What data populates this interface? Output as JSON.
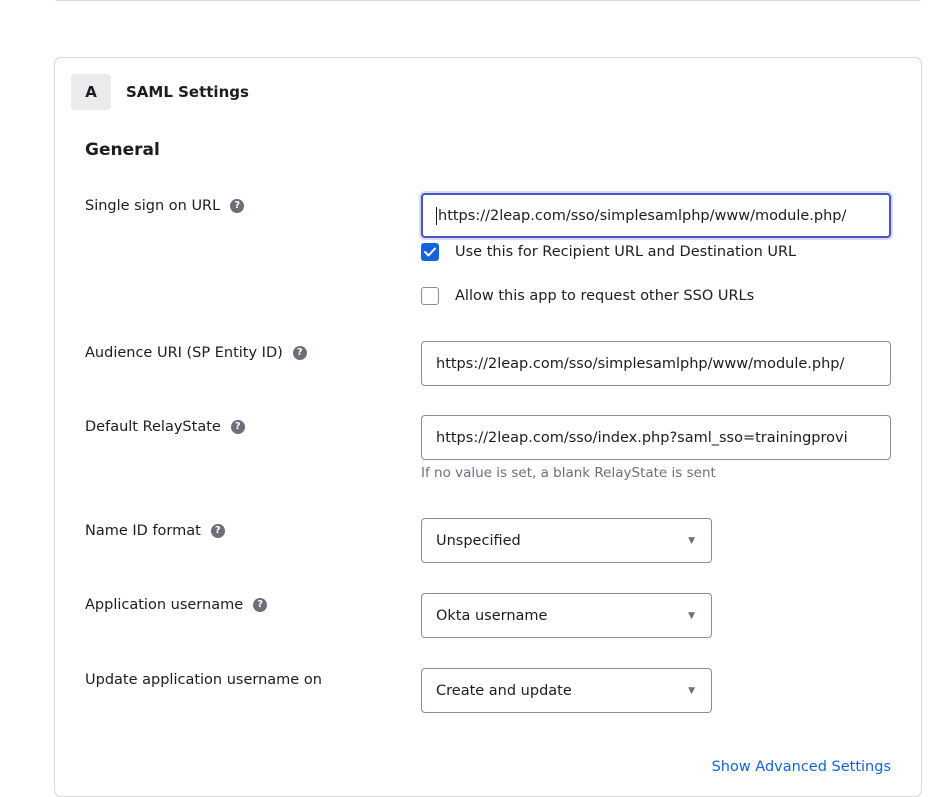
{
  "step": {
    "badge": "A",
    "title": "SAML Settings"
  },
  "section": {
    "title": "General"
  },
  "fields": {
    "sso_url": {
      "label": "Single sign on URL",
      "value": "https://2leap.com/sso/simplesamlphp/www/module.php/"
    },
    "recipient_checkbox": {
      "label": "Use this for Recipient URL and Destination URL",
      "checked": true
    },
    "other_sso_checkbox": {
      "label": "Allow this app to request other SSO URLs",
      "checked": false
    },
    "audience_uri": {
      "label": "Audience URI (SP Entity ID)",
      "value": "https://2leap.com/sso/simplesamlphp/www/module.php/"
    },
    "relay_state": {
      "label": "Default RelayState",
      "value": "https://2leap.com/sso/index.php?saml_sso=trainingprovi",
      "hint": "If no value is set, a blank RelayState is sent"
    },
    "name_id_format": {
      "label": "Name ID format",
      "value": "Unspecified"
    },
    "app_username": {
      "label": "Application username",
      "value": "Okta username"
    },
    "update_username_on": {
      "label": "Update application username on",
      "value": "Create and update"
    }
  },
  "links": {
    "advanced": "Show Advanced Settings"
  },
  "icons": {
    "help": "?",
    "check": "check-icon",
    "chevron": "chevron-down-icon"
  },
  "colors": {
    "accent": "#1662dd",
    "focus_border": "#4a54c8",
    "border": "#8c8c96",
    "hint": "#6e6e78"
  }
}
